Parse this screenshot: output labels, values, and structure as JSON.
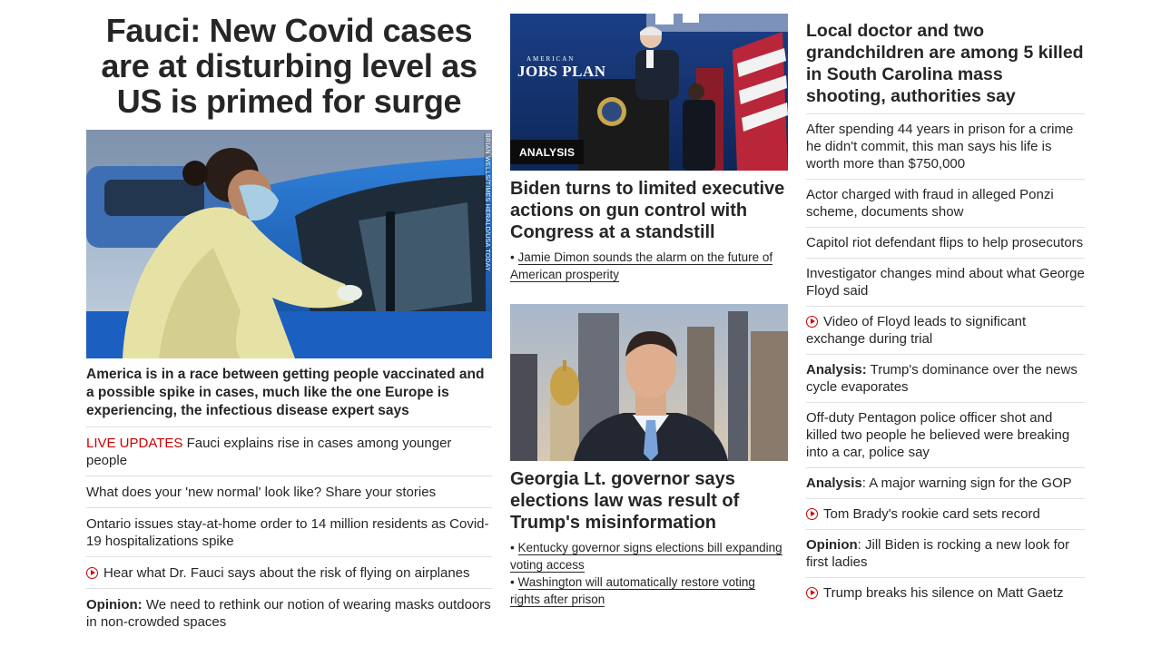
{
  "col1": {
    "headline": "Fauci: New Covid cases are at disturbing level as US is primed for surge",
    "image_credit": "BRIAN WELLS/TIMES HERALD/USA TODAY",
    "subheadline": "America is in a race between getting people vaccinated and a possible spike in cases, much like the one Europe is experiencing, the infectious disease expert says",
    "items": [
      {
        "prefix": "LIVE UPDATES",
        "text": " Fauci explains rise in cases among younger people"
      },
      {
        "text": "What does your 'new normal' look like? Share your stories"
      },
      {
        "text": "Ontario issues stay-at-home order to 14 million residents as Covid-19 hospitalizations spike"
      },
      {
        "text": "Hear what Dr. Fauci says about the risk of flying on airplanes"
      },
      {
        "prefix": "Opinion:",
        "text": " We need to rethink our notion of wearing masks outdoors in non-crowded spaces"
      }
    ]
  },
  "col2": {
    "card1": {
      "badge": "ANALYSIS",
      "sign_line1": "AMERICAN",
      "sign_line2": "JOBS PLAN",
      "title": "Biden turns to limited executive actions on gun control with Congress at a standstill",
      "links": [
        "Jamie Dimon sounds the alarm on the future of American prosperity"
      ]
    },
    "card2": {
      "title": "Georgia Lt. governor says elections law was result of Trump's misinformation",
      "links": [
        "Kentucky governor signs elections bill expanding voting access",
        "Washington will automatically restore voting rights after prison"
      ]
    },
    "bullet": "•"
  },
  "col3": {
    "headline": "Local doctor and two grandchildren are among 5 killed in South Carolina mass shooting, authorities say",
    "items": [
      {
        "text": "After spending 44 years in prison for a crime he didn't commit, this man says his life is worth more than $750,000"
      },
      {
        "text": "Actor charged with fraud in alleged Ponzi scheme, documents show"
      },
      {
        "text": "Capitol riot defendant flips to help prosecutors"
      },
      {
        "text": "Investigator changes mind about what George Floyd said"
      },
      {
        "text": "Video of Floyd leads to significant exchange during trial"
      },
      {
        "prefix": "Analysis:",
        "text": " Trump's dominance over the news cycle evaporates"
      },
      {
        "text": "Off-duty Pentagon police officer shot and killed two people he believed were breaking into a car, police say"
      },
      {
        "prefix": "Analysis",
        "text": ": A major warning sign for the GOP"
      },
      {
        "text": "Tom Brady's rookie card sets record"
      },
      {
        "prefix": "Opinion",
        "text": ": Jill Biden is rocking a new look for first ladies"
      },
      {
        "text": "Trump breaks his silence on Matt Gaetz"
      }
    ]
  },
  "icons": {
    "video": "play-circle-icon",
    "accent": "#cc0000"
  }
}
